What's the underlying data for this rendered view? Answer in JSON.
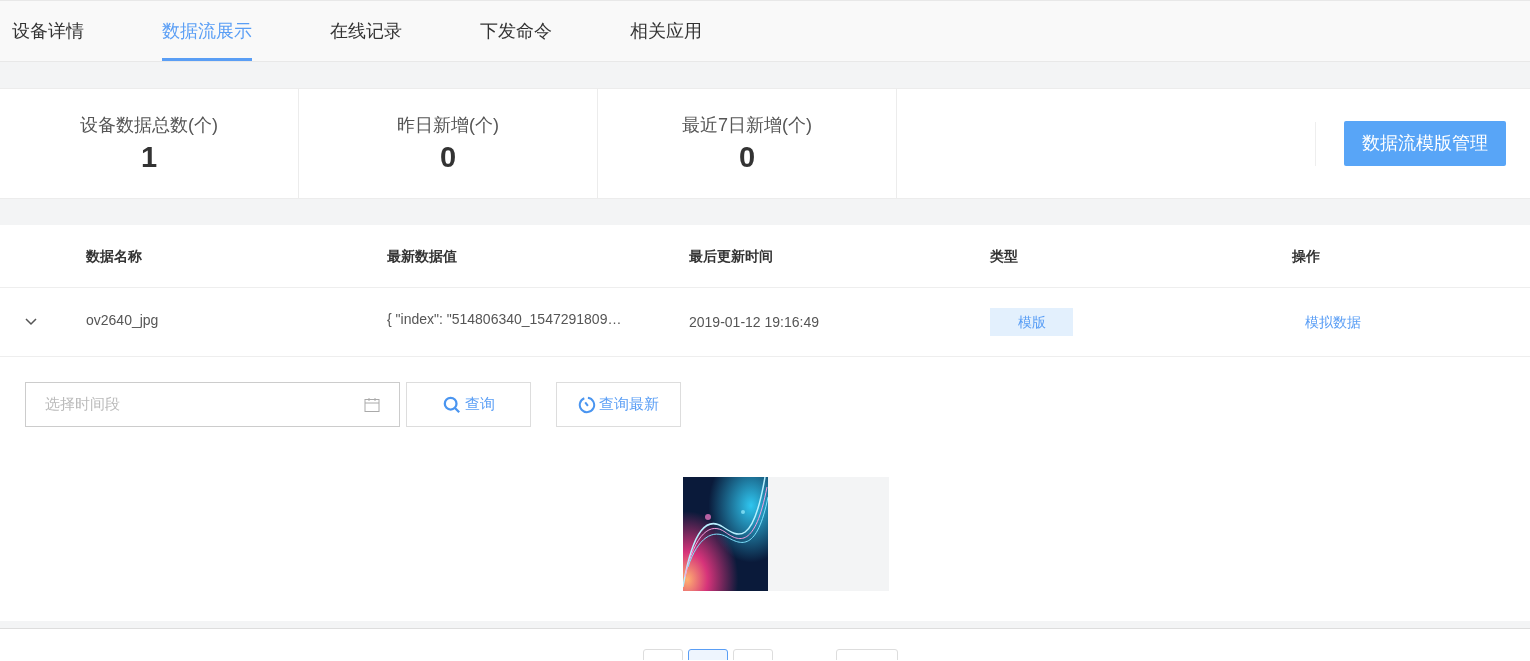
{
  "tabs": [
    {
      "label": "设备详情",
      "selected": false
    },
    {
      "label": "数据流展示",
      "selected": true
    },
    {
      "label": "在线记录",
      "selected": false
    },
    {
      "label": "下发命令",
      "selected": false
    },
    {
      "label": "相关应用",
      "selected": false
    }
  ],
  "stats": [
    {
      "label": "设备数据总数(个)",
      "value": "1"
    },
    {
      "label": "昨日新增(个)",
      "value": "0"
    },
    {
      "label": "最近7日新增(个)",
      "value": "0"
    }
  ],
  "manage_button": "数据流模版管理",
  "table": {
    "columns": [
      "数据名称",
      "最新数据值",
      "最后更新时间",
      "类型",
      "操作"
    ],
    "rows": [
      {
        "expanded": true,
        "name": "ov2640_jpg",
        "value": "{ \"index\": \"514806340_1547291809…",
        "time": "2019-01-12 19:16:49",
        "type": "模版",
        "action": "模拟数据"
      }
    ]
  },
  "filter": {
    "placeholder": "选择时间段",
    "query_button": "查询",
    "latest_button": "查询最新"
  },
  "pagination": [
    {
      "selected": false
    },
    {
      "selected": true
    },
    {
      "selected": false
    },
    {
      "selected": false
    }
  ]
}
